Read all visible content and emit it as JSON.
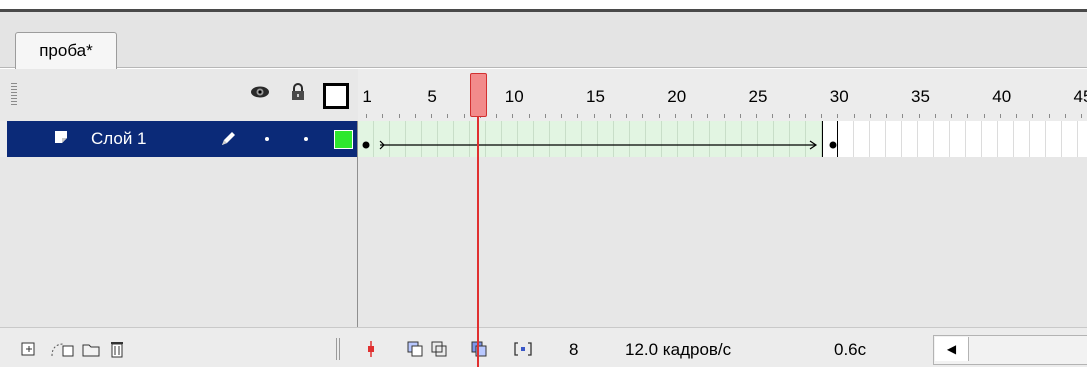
{
  "document_tab": {
    "label": "проба*"
  },
  "ruler": {
    "labels": [
      "1",
      "5",
      "10",
      "15",
      "20",
      "25",
      "30",
      "35",
      "40",
      "45"
    ]
  },
  "layer": {
    "name": "Слой 1",
    "color": "#2ee82e"
  },
  "header_icons": {
    "show_hide": "eye-icon",
    "lock": "lock-icon",
    "outline": "outline-icon"
  },
  "bottom_bar": {
    "current_frame": "8",
    "frame_rate": "12.0 кадров/с",
    "elapsed_time": "0.6с"
  },
  "colors": {
    "selection": "#0b2a78",
    "playhead": "#e03030",
    "tween": "#e2f5e2"
  }
}
